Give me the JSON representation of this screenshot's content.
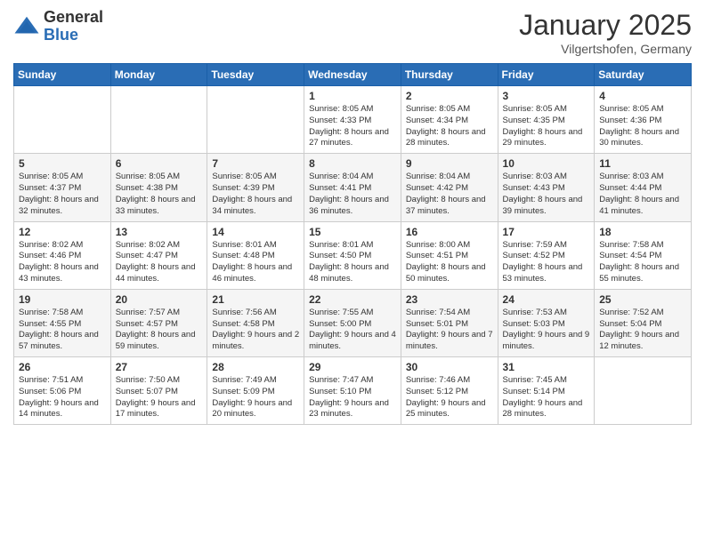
{
  "header": {
    "logo_general": "General",
    "logo_blue": "Blue",
    "month": "January 2025",
    "location": "Vilgertshofen, Germany"
  },
  "weekdays": [
    "Sunday",
    "Monday",
    "Tuesday",
    "Wednesday",
    "Thursday",
    "Friday",
    "Saturday"
  ],
  "weeks": [
    [
      {
        "day": "",
        "info": ""
      },
      {
        "day": "",
        "info": ""
      },
      {
        "day": "",
        "info": ""
      },
      {
        "day": "1",
        "info": "Sunrise: 8:05 AM\nSunset: 4:33 PM\nDaylight: 8 hours and 27 minutes."
      },
      {
        "day": "2",
        "info": "Sunrise: 8:05 AM\nSunset: 4:34 PM\nDaylight: 8 hours and 28 minutes."
      },
      {
        "day": "3",
        "info": "Sunrise: 8:05 AM\nSunset: 4:35 PM\nDaylight: 8 hours and 29 minutes."
      },
      {
        "day": "4",
        "info": "Sunrise: 8:05 AM\nSunset: 4:36 PM\nDaylight: 8 hours and 30 minutes."
      }
    ],
    [
      {
        "day": "5",
        "info": "Sunrise: 8:05 AM\nSunset: 4:37 PM\nDaylight: 8 hours and 32 minutes."
      },
      {
        "day": "6",
        "info": "Sunrise: 8:05 AM\nSunset: 4:38 PM\nDaylight: 8 hours and 33 minutes."
      },
      {
        "day": "7",
        "info": "Sunrise: 8:05 AM\nSunset: 4:39 PM\nDaylight: 8 hours and 34 minutes."
      },
      {
        "day": "8",
        "info": "Sunrise: 8:04 AM\nSunset: 4:41 PM\nDaylight: 8 hours and 36 minutes."
      },
      {
        "day": "9",
        "info": "Sunrise: 8:04 AM\nSunset: 4:42 PM\nDaylight: 8 hours and 37 minutes."
      },
      {
        "day": "10",
        "info": "Sunrise: 8:03 AM\nSunset: 4:43 PM\nDaylight: 8 hours and 39 minutes."
      },
      {
        "day": "11",
        "info": "Sunrise: 8:03 AM\nSunset: 4:44 PM\nDaylight: 8 hours and 41 minutes."
      }
    ],
    [
      {
        "day": "12",
        "info": "Sunrise: 8:02 AM\nSunset: 4:46 PM\nDaylight: 8 hours and 43 minutes."
      },
      {
        "day": "13",
        "info": "Sunrise: 8:02 AM\nSunset: 4:47 PM\nDaylight: 8 hours and 44 minutes."
      },
      {
        "day": "14",
        "info": "Sunrise: 8:01 AM\nSunset: 4:48 PM\nDaylight: 8 hours and 46 minutes."
      },
      {
        "day": "15",
        "info": "Sunrise: 8:01 AM\nSunset: 4:50 PM\nDaylight: 8 hours and 48 minutes."
      },
      {
        "day": "16",
        "info": "Sunrise: 8:00 AM\nSunset: 4:51 PM\nDaylight: 8 hours and 50 minutes."
      },
      {
        "day": "17",
        "info": "Sunrise: 7:59 AM\nSunset: 4:52 PM\nDaylight: 8 hours and 53 minutes."
      },
      {
        "day": "18",
        "info": "Sunrise: 7:58 AM\nSunset: 4:54 PM\nDaylight: 8 hours and 55 minutes."
      }
    ],
    [
      {
        "day": "19",
        "info": "Sunrise: 7:58 AM\nSunset: 4:55 PM\nDaylight: 8 hours and 57 minutes."
      },
      {
        "day": "20",
        "info": "Sunrise: 7:57 AM\nSunset: 4:57 PM\nDaylight: 8 hours and 59 minutes."
      },
      {
        "day": "21",
        "info": "Sunrise: 7:56 AM\nSunset: 4:58 PM\nDaylight: 9 hours and 2 minutes."
      },
      {
        "day": "22",
        "info": "Sunrise: 7:55 AM\nSunset: 5:00 PM\nDaylight: 9 hours and 4 minutes."
      },
      {
        "day": "23",
        "info": "Sunrise: 7:54 AM\nSunset: 5:01 PM\nDaylight: 9 hours and 7 minutes."
      },
      {
        "day": "24",
        "info": "Sunrise: 7:53 AM\nSunset: 5:03 PM\nDaylight: 9 hours and 9 minutes."
      },
      {
        "day": "25",
        "info": "Sunrise: 7:52 AM\nSunset: 5:04 PM\nDaylight: 9 hours and 12 minutes."
      }
    ],
    [
      {
        "day": "26",
        "info": "Sunrise: 7:51 AM\nSunset: 5:06 PM\nDaylight: 9 hours and 14 minutes."
      },
      {
        "day": "27",
        "info": "Sunrise: 7:50 AM\nSunset: 5:07 PM\nDaylight: 9 hours and 17 minutes."
      },
      {
        "day": "28",
        "info": "Sunrise: 7:49 AM\nSunset: 5:09 PM\nDaylight: 9 hours and 20 minutes."
      },
      {
        "day": "29",
        "info": "Sunrise: 7:47 AM\nSunset: 5:10 PM\nDaylight: 9 hours and 23 minutes."
      },
      {
        "day": "30",
        "info": "Sunrise: 7:46 AM\nSunset: 5:12 PM\nDaylight: 9 hours and 25 minutes."
      },
      {
        "day": "31",
        "info": "Sunrise: 7:45 AM\nSunset: 5:14 PM\nDaylight: 9 hours and 28 minutes."
      },
      {
        "day": "",
        "info": ""
      }
    ]
  ]
}
